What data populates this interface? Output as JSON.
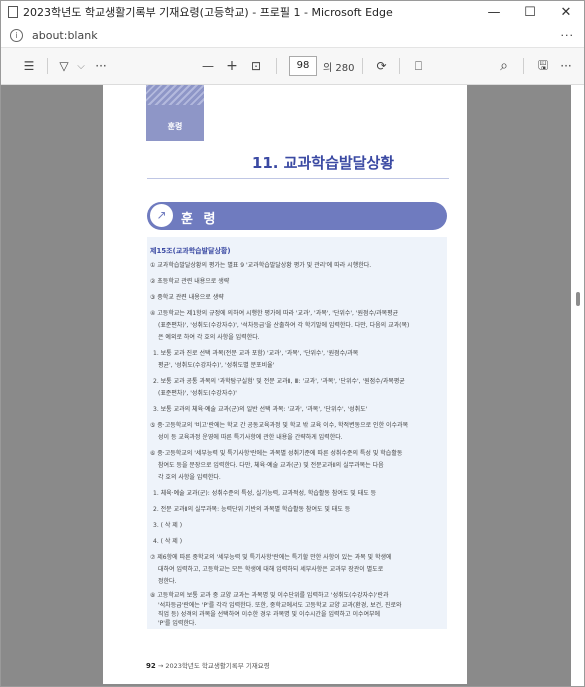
{
  "window": {
    "title": "2023학년도 학교생활기록부 기재요령(고등학교) - 프로필 1 - Microsoft Edge",
    "minimize": "—",
    "maximize": "☐",
    "close": "✕"
  },
  "address": {
    "info": "i",
    "url": "about:blank",
    "more": "···"
  },
  "toolbar": {
    "contents": "☰",
    "draw": "▽",
    "draw_dropdown": "⌵",
    "more": "···",
    "zoom_out": "—",
    "zoom_in": "+",
    "fit": "⊡",
    "page_current": "98",
    "page_total": "의 280",
    "rotate": "⟳",
    "two_page": "⎕",
    "search": "⌕",
    "save": "🖫",
    "menu": "···"
  },
  "page": {
    "header_label": "훈령",
    "chapter_title": "11. 교과학습발달상황",
    "section_icon": "↗",
    "section_title": "훈 령",
    "article_title": "제15조(교과학습발달상황)",
    "paragraphs": [
      "① 교과학습발달상황의 평가는 별표 9 '교과학습발달상황 평가 및 관리'에 따라 시행한다.",
      "② 초등학교 관련 내용으로 생략",
      "③ 중학교 관련 내용으로 생략",
      "④ 고등학교는 제1항의 규정에 의하여 시행한 평가에 따라 '교과', '과목', '단위수', '원점수/과목평균",
      "(표준편차)', '성취도(수강자수)', '석차등급'을 산출하여 각 학기말에 입력한다. 다만, 다음의 교과(목)",
      "은 예외로 하여 각 호의 사항을 입력한다.",
      "1. 보통 교과 진로 선택 과목(전문 교과 포함) '교과', '과목', '단위수', '원점수/과목",
      "평균', '성취도(수강자수)', '성취도별 분포비율'",
      "2. 보통 교과 공통 과목의 '과학탐구실험' 및 전문 교과Ⅱ, Ⅲ: '교과', '과목', '단위수', '원점수/과목평균",
      "(표준편차)', '성취도(수강자수)'",
      "3. 보통 교과의 체육·예술 교과(군)의 일반 선택 과목: '교과', '과목', '단위수', '성취도'",
      "⑤ 중·고등학교의 '비고'란에는 학교 간 공동교육과정 및 학교 밖 교육 이수, 학적변동으로 인한 이수과목",
      "성이 등 교육과정 운영에 따른 특기사항에 관한 내용을 간략하게 입력한다.",
      "⑥ 중·고등학교의 '세부능력 및 특기사항'란에는 과목별 성취기준에 따른 성취수준의 특성 및 학습활동",
      "참여도 등을 문장으로 입력한다. 다만, 체육·예술 교과(군) 및 전문교과Ⅱ의 실무과목는 다음",
      "각 호의 사항을 입력한다.",
      "1. 체육·예술 교과(군): 성취수준의 특성, 실기능력, 교과적성, 학습활동 참여도 및 태도 등",
      "2. 전문 교과Ⅱ의 실무과목: 능력단위 기반의 과목별 학습활동 참여도 및 태도 등",
      "3. ( 삭 제 )",
      "4. ( 삭 제 )",
      "⑦ 제6항에 따른 중학교의 '세부능력 및 특기사항'란에는 특기할 만한 사항이 있는 과목 및 학생에",
      "대하여 입력하고, 고등학교는 모든 학생에 대해 입력하되 세부사항은 교과부 장관이 별도로",
      "정한다.",
      "⑧ 고등학교의 보통 교과 중 교양 교과는 과목명 및 이수단위를 입력하고 '성취도(수강자수)'란과",
      "'석차등급'란에는 'P'를 각각 입력한다. 또한, 중학교에서도 고등학교 교양 교과(환경, 보건, 진로와",
      "직업 등) 성격의 과목을 선택하여 이수한 경우 과목명 및 이수시간을 입력하고 이수여부에",
      "'P'를 입력한다."
    ],
    "footer_num": "92",
    "footer_text": "→ 2023학년도 학교생활기록부 기재요령"
  }
}
